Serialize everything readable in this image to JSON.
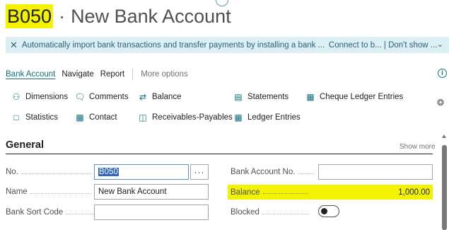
{
  "title": {
    "code": "B050",
    "separator": "·",
    "name": "New Bank Account"
  },
  "banner": {
    "message": "Automatically import bank transactions and transfer payments by installing a bank ...",
    "link": "Connect to b... | Don't show ..."
  },
  "menu": {
    "items": [
      "Bank Account",
      "Navigate",
      "Report"
    ],
    "more": "More options"
  },
  "actions": {
    "dimensions": "Dimensions",
    "comments": "Comments",
    "balance": "Balance",
    "statements": "Statements",
    "cheque_ledger_entries": "Cheque Ledger Entries",
    "statistics": "Statistics",
    "contact": "Contact",
    "receivables_payables": "Receivables-Payables",
    "ledger_entries": "Ledger Entries"
  },
  "general": {
    "title": "General",
    "show_more": "Show more",
    "no_label": "No.",
    "no_value": "B050",
    "name_label": "Name",
    "name_value": "New Bank Account",
    "sort_code_label": "Bank Sort Code",
    "sort_code_value": "",
    "bank_account_no_label": "Bank Account No.",
    "bank_account_no_value": "",
    "balance_label": "Balance",
    "balance_value": "1,000.00",
    "blocked_label": "Blocked",
    "blocked_value": false
  },
  "colors": {
    "highlight": "#f3f200",
    "accent": "#0f6f79",
    "banner_bg": "#dbeff4"
  }
}
